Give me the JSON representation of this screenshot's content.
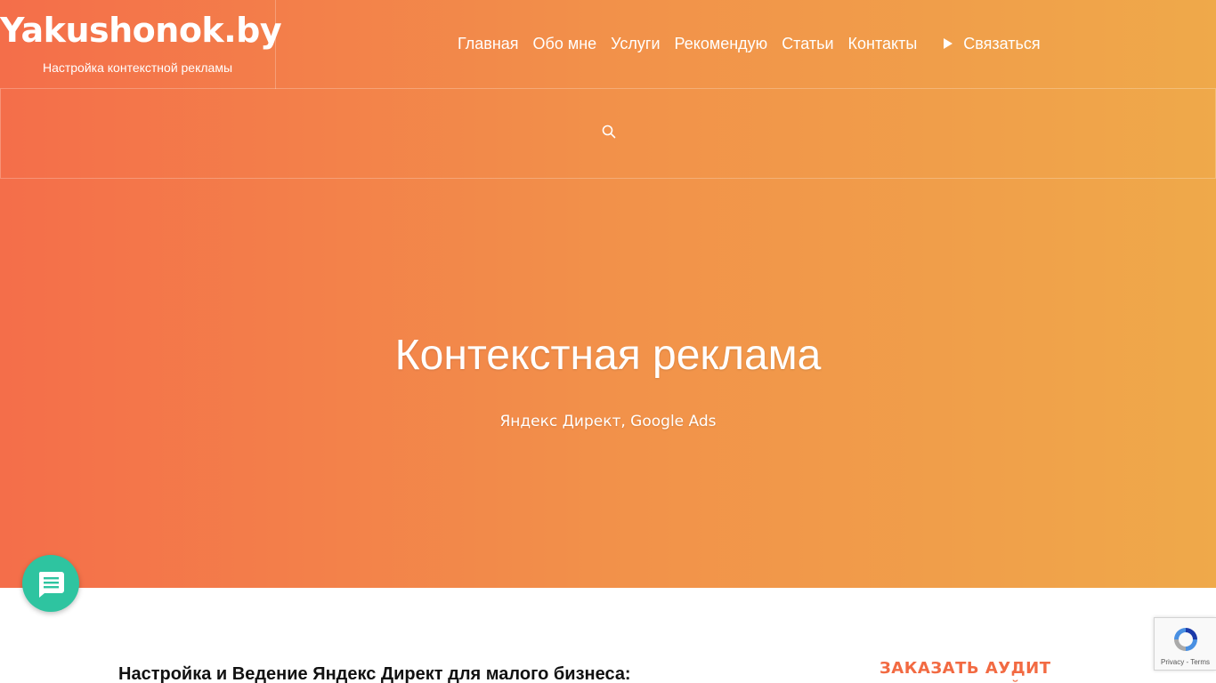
{
  "header": {
    "site_title": "Yakushonok.by",
    "tagline": "Настройка контекстной рекламы"
  },
  "nav": {
    "items": [
      {
        "label": "Главная"
      },
      {
        "label": "Обо мне"
      },
      {
        "label": "Услуги"
      },
      {
        "label": "Рекомендую"
      },
      {
        "label": "Статьи"
      },
      {
        "label": "Контакты"
      }
    ],
    "contact_label": "Связаться",
    "contact_icon": "play-icon"
  },
  "search": {
    "icon": "search-icon"
  },
  "hero": {
    "title": "Контекстная реклама",
    "subtitle": "Яндекс Директ, Google Ads",
    "gradient_start": "#f46e4a",
    "gradient_end": "#efa94a"
  },
  "content": {
    "heading": "Настройка и Ведение Яндекс Директ для малого бизнеса:"
  },
  "sidebar": {
    "heading": "ЗАКАЗАТЬ АУДИТ КОНТЕКСТНОЙ"
  },
  "chat": {
    "icon": "chat-icon",
    "color": "#2ec4a0"
  },
  "recaptcha": {
    "privacy": "Privacy",
    "separator": " - ",
    "terms": "Terms"
  }
}
